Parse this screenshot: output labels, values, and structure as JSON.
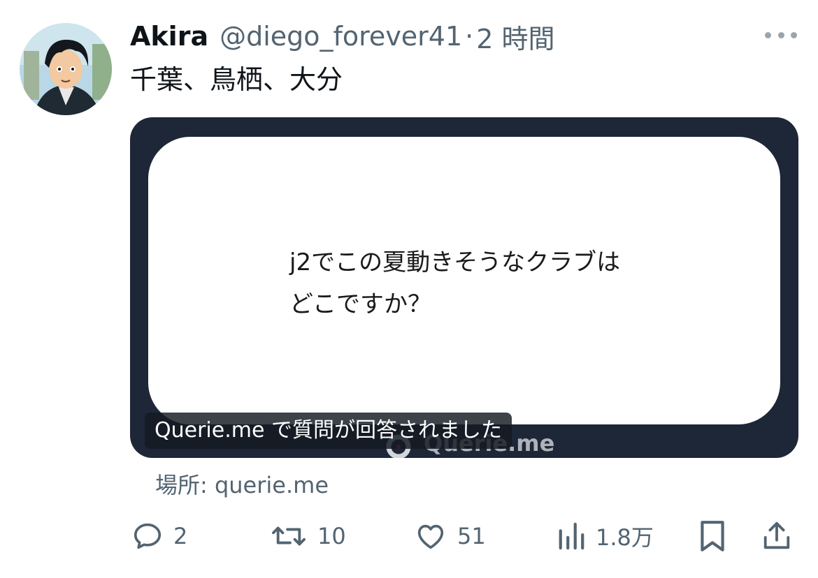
{
  "tweet": {
    "display_name": "Akira",
    "handle": "@diego_forever41",
    "separator": "·",
    "time": "2 時間",
    "text": "千葉、鳥栖、大分",
    "more_icon": "more-horizontal-icon",
    "avatar_icon": "anime-character-avatar"
  },
  "card": {
    "question_line1": "j2でこの夏動きそうなクラブは",
    "question_line2": "どこですか？",
    "caption": "Querie.me で質問が回答されました",
    "watermark": "Querie.me",
    "source_label": "場所: querie.me",
    "colors": {
      "frame": "#1e2737",
      "panel": "#ffffff"
    }
  },
  "actions": {
    "reply": {
      "icon": "reply-icon",
      "count": "2"
    },
    "retweet": {
      "icon": "retweet-icon",
      "count": "10"
    },
    "like": {
      "icon": "heart-icon",
      "count": "51"
    },
    "views": {
      "icon": "views-chart-icon",
      "count": "1.8万"
    },
    "bookmark": {
      "icon": "bookmark-icon"
    },
    "share": {
      "icon": "share-icon"
    }
  },
  "colors": {
    "text": "#0f1419",
    "secondary": "#536471"
  }
}
